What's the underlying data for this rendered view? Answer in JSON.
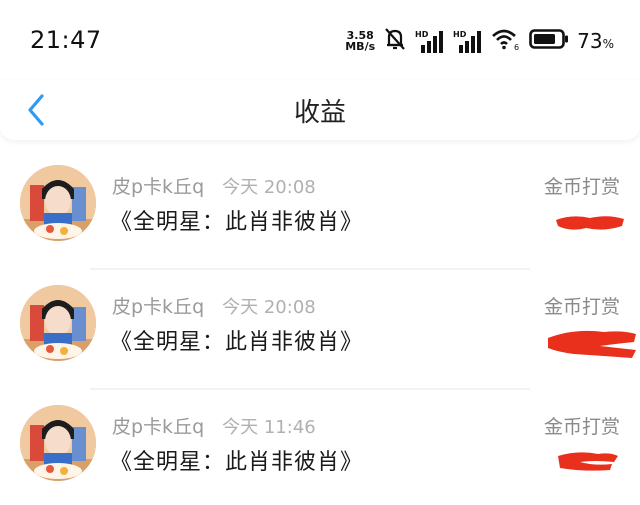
{
  "status_bar": {
    "time": "21:47",
    "net_speed_value": "3.58",
    "net_speed_unit": "MB/s",
    "hd_label_1": "HD",
    "hd_label_2": "HD",
    "wifi_badge": "6",
    "battery_percent": "73",
    "battery_percent_sign": "%",
    "icons": [
      "mute-bell-icon",
      "signal-icon",
      "signal-icon",
      "wifi-icon",
      "battery-icon"
    ]
  },
  "header": {
    "back_icon": "chevron-left-icon",
    "title": "收益"
  },
  "colors": {
    "accent": "#2f9bf0",
    "redaction": "#e8301c",
    "name_gray": "#9a9a9a",
    "title_text": "#1a1a1a"
  },
  "records": [
    {
      "user": "皮p卡k丘q",
      "time": "今天 20:08",
      "work": "《全明星：此肖非彼肖》",
      "type": "金币打赏"
    },
    {
      "user": "皮p卡k丘q",
      "time": "今天 20:08",
      "work": "《全明星：此肖非彼肖》",
      "type": "金币打赏"
    },
    {
      "user": "皮p卡k丘q",
      "time": "今天 11:46",
      "work": "《全明星：此肖非彼肖》",
      "type": "金币打赏"
    }
  ]
}
